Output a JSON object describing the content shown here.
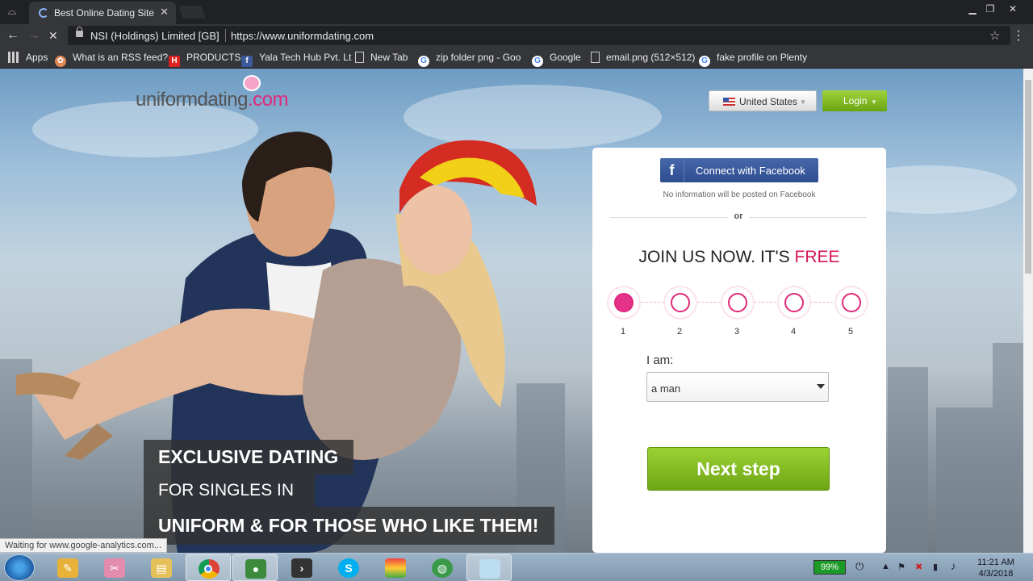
{
  "browser": {
    "tab_title": "Best Online Dating Site |",
    "tab_close": "✕",
    "site_identity": "NSI (Holdings) Limited [GB]",
    "url": "https://www.uniformdating.com",
    "bookmarks": [
      {
        "label": "Apps",
        "icon": "apps-grid-icon"
      },
      {
        "label": "What is an RSS feed?",
        "icon": "rss-globe-icon"
      },
      {
        "label": "PRODUCTS",
        "icon": "h-logo-icon"
      },
      {
        "label": "Yala Tech Hub Pvt. Lt",
        "icon": "facebook-icon"
      },
      {
        "label": "New Tab",
        "icon": "page-icon"
      },
      {
        "label": "zip folder png - Goo",
        "icon": "google-icon"
      },
      {
        "label": "Google",
        "icon": "google-icon"
      },
      {
        "label": "email.png (512×512)",
        "icon": "page-icon"
      },
      {
        "label": "fake profile on Plenty",
        "icon": "google-icon"
      }
    ]
  },
  "site": {
    "logo_text": "uniformdating",
    "logo_tld": ".com",
    "country_label": "United States",
    "login_label": "Login",
    "promo_line1": "EXCLUSIVE DATING",
    "promo_line2": "FOR SINGLES IN",
    "promo_line3": "UNIFORM & FOR THOSE WHO LIKE THEM!"
  },
  "signup": {
    "facebook_button": "Connect with Facebook",
    "facebook_note": "No information will be posted on Facebook",
    "or_text": "or",
    "join_text": "JOIN US NOW. IT'S",
    "join_free": "FREE",
    "steps": [
      "1",
      "2",
      "3",
      "4",
      "5"
    ],
    "current_step": 1,
    "iam_label": "I am:",
    "gender_value": "a man",
    "next_button": "Next step"
  },
  "status_bar": "Waiting for www.google-analytics.com...",
  "taskbar": {
    "battery": "99%",
    "time": "11:21 AM",
    "date": "4/3/2018"
  },
  "colors": {
    "brand_pink": "#e0297a",
    "green_button": "#7cb51f",
    "facebook_blue": "#3b5998"
  }
}
